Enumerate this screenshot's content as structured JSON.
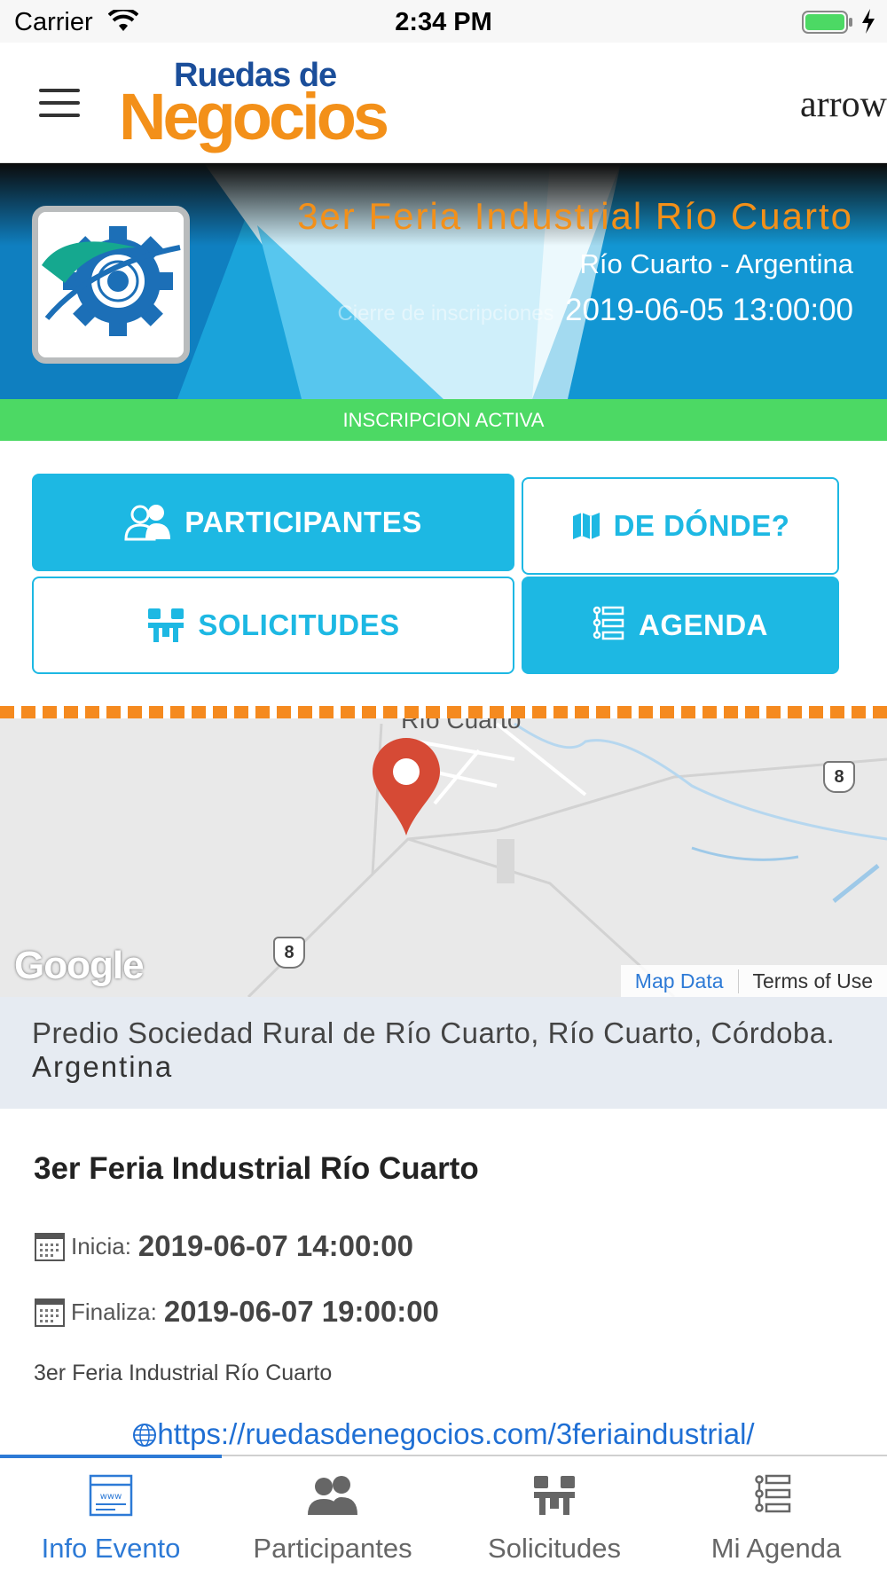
{
  "status_bar": {
    "carrier": "Carrier",
    "time": "2:34 PM"
  },
  "header": {
    "logo_top": "Ruedas de",
    "logo_bottom": "Negocios",
    "right_text": "arrow"
  },
  "banner": {
    "title": "3er Feria Industrial Río Cuarto",
    "location": "Río Cuarto - Argentina",
    "date_label": "Cierre de inscripciones",
    "date": "2019-06-05 13:00:00",
    "status": "INSCRIPCION ACTIVA"
  },
  "actions": {
    "participantes": "PARTICIPANTES",
    "donde": "DE DÓNDE?",
    "solicitudes": "SOLICITUDES",
    "agenda": "AGENDA"
  },
  "map": {
    "city": "Río Cuarto",
    "route_1": "8",
    "route_2": "8",
    "google": "Google",
    "map_data": "Map Data",
    "terms": "Terms of Use"
  },
  "address": {
    "line": "Predio Sociedad Rural de Río Cuarto, Río Cuarto, Córdoba.",
    "country": "Argentina"
  },
  "event": {
    "title": "3er Feria Industrial Río Cuarto",
    "start_label": "Inicia:",
    "start": "2019-06-07 14:00:00",
    "end_label": "Finaliza:",
    "end": "2019-06-07 19:00:00",
    "description": "3er Feria Industrial Río Cuarto",
    "url": "https://ruedasdenegocios.com/3feriaindustrial/"
  },
  "tabs": [
    {
      "label": "Info Evento",
      "icon": "web-page-icon",
      "active": true
    },
    {
      "label": "Participantes",
      "icon": "people-icon",
      "active": false
    },
    {
      "label": "Solicitudes",
      "icon": "meeting-icon",
      "active": false
    },
    {
      "label": "Mi Agenda",
      "icon": "agenda-list-icon",
      "active": false
    }
  ],
  "colors": {
    "accent": "#1db8e3",
    "brand_orange": "#f39019",
    "status_green": "#4cd964",
    "tab_active": "#2d7ad6",
    "map_pin": "#d64a35"
  }
}
